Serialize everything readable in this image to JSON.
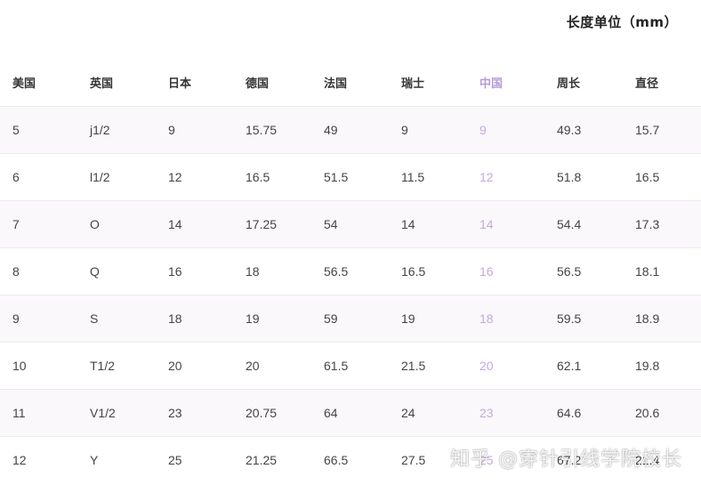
{
  "unit_label": "长度单位（mm）",
  "table": {
    "headers": [
      "美国",
      "英国",
      "日本",
      "德国",
      "法国",
      "瑞士",
      "中国",
      "周长",
      "直径"
    ],
    "rows": [
      [
        "5",
        "j1/2",
        "9",
        "15.75",
        "49",
        "9",
        "9",
        "49.3",
        "15.7"
      ],
      [
        "6",
        "l1/2",
        "12",
        "16.5",
        "51.5",
        "11.5",
        "12",
        "51.8",
        "16.5"
      ],
      [
        "7",
        "O",
        "14",
        "17.25",
        "54",
        "14",
        "14",
        "54.4",
        "17.3"
      ],
      [
        "8",
        "Q",
        "16",
        "18",
        "56.5",
        "16.5",
        "16",
        "56.5",
        "18.1"
      ],
      [
        "9",
        "S",
        "18",
        "19",
        "59",
        "19",
        "18",
        "59.5",
        "18.9"
      ],
      [
        "10",
        "T1/2",
        "20",
        "20",
        "61.5",
        "21.5",
        "20",
        "62.1",
        "19.8"
      ],
      [
        "11",
        "V1/2",
        "23",
        "20.75",
        "64",
        "24",
        "23",
        "64.6",
        "20.6"
      ],
      [
        "12",
        "Y",
        "25",
        "21.25",
        "66.5",
        "27.5",
        "25",
        "67.2",
        "21.4"
      ]
    ]
  },
  "watermark": "知乎 @穿针引线学院校长",
  "colors": {
    "china_column": "#c5a8e0",
    "row_stripe": "#faf8fa"
  }
}
